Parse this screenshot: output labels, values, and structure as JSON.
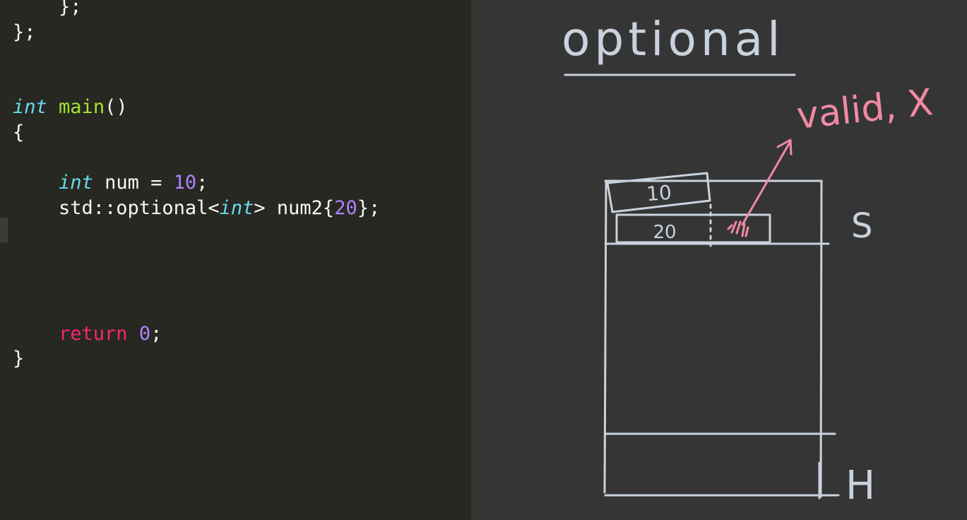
{
  "editor": {
    "lines": [
      [
        {
          "t": "    };",
          "k": "plain"
        }
      ],
      [
        {
          "t": "};",
          "k": "plain"
        }
      ],
      [],
      [],
      [
        {
          "t": "int",
          "k": "type"
        },
        {
          "t": " ",
          "k": "plain"
        },
        {
          "t": "main",
          "k": "func"
        },
        {
          "t": "()",
          "k": "plain"
        }
      ],
      [
        {
          "t": "{",
          "k": "plain"
        }
      ],
      [],
      [
        {
          "t": "    ",
          "k": "plain"
        },
        {
          "t": "int",
          "k": "type"
        },
        {
          "t": " num = ",
          "k": "plain"
        },
        {
          "t": "10",
          "k": "num"
        },
        {
          "t": ";",
          "k": "plain"
        }
      ],
      [
        {
          "t": "    std::optional<",
          "k": "plain"
        },
        {
          "t": "int",
          "k": "type"
        },
        {
          "t": "> num2{",
          "k": "plain"
        },
        {
          "t": "20",
          "k": "num"
        },
        {
          "t": "};",
          "k": "plain"
        }
      ],
      [],
      [],
      [],
      [],
      [
        {
          "t": "    ",
          "k": "plain"
        },
        {
          "t": "return",
          "k": "kw"
        },
        {
          "t": " ",
          "k": "plain"
        },
        {
          "t": "0",
          "k": "num"
        },
        {
          "t": ";",
          "k": "plain"
        }
      ],
      [
        {
          "t": "}",
          "k": "plain"
        }
      ]
    ],
    "colors": {
      "background": "#272822",
      "type": "#66d9ef",
      "func": "#a6e22e",
      "num": "#ae81ff",
      "kw": "#f92672",
      "plain": "#f8f8f2"
    }
  },
  "whiteboard": {
    "title": "optional",
    "stack_value_1": "10",
    "stack_value_2": "20",
    "annotation": "valid, X",
    "stack_label": "S",
    "heap_label": "H",
    "colors": {
      "background": "#353535",
      "chalk": "#c9d2dd",
      "ink": "#f08aa4"
    }
  }
}
